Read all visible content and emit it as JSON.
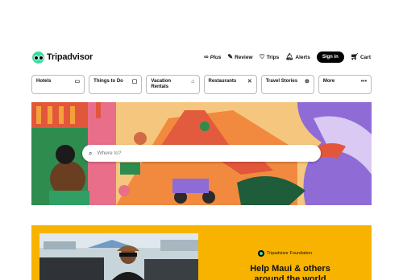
{
  "header": {
    "logo_text": "Tripadvisor",
    "nav": {
      "plus": "Plus",
      "review": "Review",
      "trips": "Trips",
      "alerts": "Alerts",
      "signin": "Sign in",
      "cart": "Cart"
    }
  },
  "categories": [
    {
      "label": "Hotels",
      "icon": "bed-icon"
    },
    {
      "label": "Things to Do",
      "icon": "ticket-icon"
    },
    {
      "label": "Vacation Rentals",
      "icon": "house-icon"
    },
    {
      "label": "Restaurants",
      "icon": "utensils-icon"
    },
    {
      "label": "Travel Stories",
      "icon": "globe-icon"
    },
    {
      "label": "More",
      "icon": "more-icon"
    }
  ],
  "search": {
    "placeholder": "Where to?"
  },
  "promo": {
    "foundation_label": "Tripadvisor Foundation",
    "title": "Help Maui & others around the world"
  },
  "colors": {
    "brand": "#34e0a1",
    "promo_bg": "#f8b300",
    "signin_bg": "#000000"
  }
}
